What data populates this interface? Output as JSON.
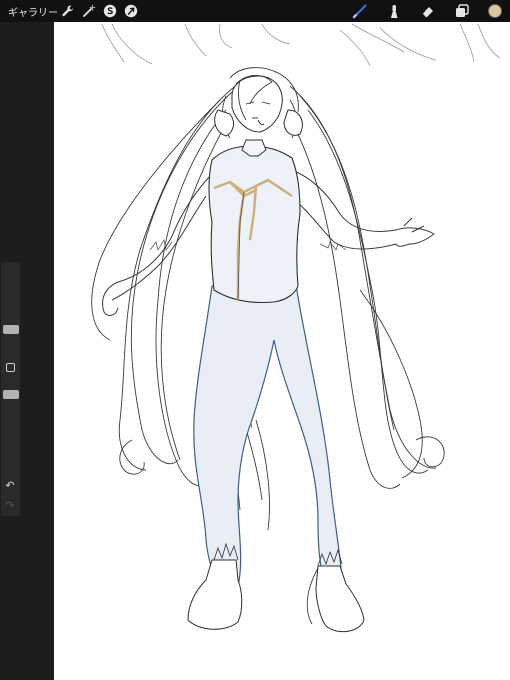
{
  "toolbar": {
    "gallery_label": "ギャラリー",
    "actions_icon": "wrench-icon",
    "adjustments_icon": "magic-wand-icon",
    "selection_icon": "selection-s-icon",
    "transform_icon": "arrow-cursor-icon"
  },
  "tools": {
    "brush_icon": "brush-icon",
    "smudge_icon": "smudge-icon",
    "eraser_icon": "eraser-icon",
    "layers_icon": "layers-icon",
    "active_color": "#d8c7a4",
    "active_tool_color": "#3b6fd6"
  },
  "sidebar": {
    "modify_icon": "square-modify-icon",
    "undo_icon": "undo-icon",
    "redo_icon": "redo-icon",
    "undo_glyph": "↶",
    "redo_glyph": "↷"
  },
  "canvas": {
    "background": "#ffffff",
    "fill_color": "#e9edf6",
    "accent_color": "#c9b07c",
    "outline_color": "#3f5f86"
  }
}
